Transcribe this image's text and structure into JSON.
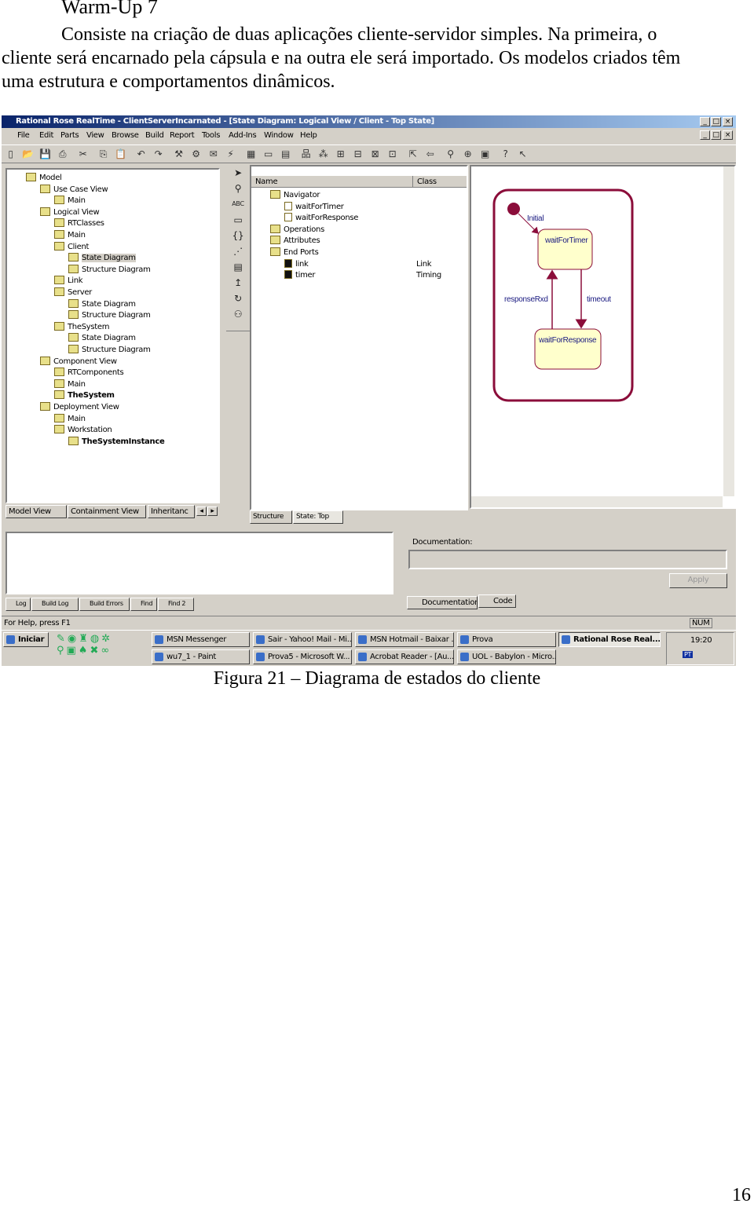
{
  "document": {
    "heading": "Warm-Up 7",
    "paragraph_lines": [
      "Consiste na criação de duas aplicações cliente-servidor simples. Na primeira, o",
      "cliente será encarnado pela cápsula e na outra ele será importado. Os modelos criados têm",
      "uma estrutura e comportamentos dinâmicos."
    ],
    "caption": "Figura 21 – Diagrama de estados do cliente",
    "page_number": "16"
  },
  "app": {
    "title": "Rational Rose RealTime - ClientServerIncarnated - [State Diagram: Logical View / Client - Top State]",
    "menu": [
      "File",
      "Edit",
      "Parts",
      "View",
      "Browse",
      "Build",
      "Report",
      "Tools",
      "Add-Ins",
      "Window",
      "Help"
    ],
    "toolbar_icons": [
      "new-icon",
      "open-icon",
      "save-icon",
      "print-icon",
      "cut-icon",
      "copy-icon",
      "paste-icon",
      "undo-icon",
      "redo-icon",
      "build-icon",
      "run-icon",
      "compile-icon",
      "lightning-icon",
      "browser-icon",
      "window-icon",
      "split-icon",
      "class-diagram-icon",
      "usecase-icon",
      "component-icon",
      "deployment-icon",
      "structure-icon",
      "state-icon",
      "navigate-icon",
      "back-icon",
      "zoom-icon",
      "fit-icon",
      "layout-icon",
      "help-icon",
      "whats-this-icon"
    ],
    "tree": [
      {
        "label": "Model",
        "level": 0
      },
      {
        "label": "Use Case View",
        "level": 1
      },
      {
        "label": "Main",
        "level": 2
      },
      {
        "label": "Logical View",
        "level": 1
      },
      {
        "label": "RTClasses",
        "level": 2
      },
      {
        "label": "Main",
        "level": 2
      },
      {
        "label": "Client",
        "level": 2
      },
      {
        "label": "State Diagram",
        "level": 3,
        "selected": true
      },
      {
        "label": "Structure Diagram",
        "level": 3
      },
      {
        "label": "Link",
        "level": 2
      },
      {
        "label": "Server",
        "level": 2
      },
      {
        "label": "State Diagram",
        "level": 3
      },
      {
        "label": "Structure Diagram",
        "level": 3
      },
      {
        "label": "TheSystem",
        "level": 2
      },
      {
        "label": "State Diagram",
        "level": 3
      },
      {
        "label": "Structure Diagram",
        "level": 3
      },
      {
        "label": "Component View",
        "level": 1
      },
      {
        "label": "RTComponents",
        "level": 2
      },
      {
        "label": "Main",
        "level": 2
      },
      {
        "label": "TheSystem",
        "level": 2,
        "bold": true
      },
      {
        "label": "Deployment View",
        "level": 1
      },
      {
        "label": "Main",
        "level": 2
      },
      {
        "label": "Workstation",
        "level": 2
      },
      {
        "label": "TheSystemInstance",
        "level": 3,
        "bold": true
      }
    ],
    "tree_tabs": [
      "Model View",
      "Containment View",
      "Inheritanc"
    ],
    "list_headers": {
      "name": "Name",
      "class": "Class"
    },
    "list_items": [
      {
        "name": "Navigator",
        "level": 0,
        "class": ""
      },
      {
        "name": "waitForTimer",
        "level": 1,
        "class": ""
      },
      {
        "name": "waitForResponse",
        "level": 1,
        "class": ""
      },
      {
        "name": "Operations",
        "level": 0,
        "class": ""
      },
      {
        "name": "Attributes",
        "level": 0,
        "class": ""
      },
      {
        "name": "End Ports",
        "level": 0,
        "class": ""
      },
      {
        "name": "link",
        "level": 1,
        "class": "Link"
      },
      {
        "name": "timer",
        "level": 1,
        "class": "Timing"
      }
    ],
    "list_tabs": [
      "Structure",
      "State: Top"
    ],
    "diagram": {
      "initial_label": "Initial",
      "state1": "waitForTimer",
      "state2": "waitForResponse",
      "transition_up": "responseRxd",
      "transition_down": "timeout",
      "state_color": "#ffffcc",
      "line_color": "#8b0d3a"
    },
    "log_tabs": [
      "Log",
      "Build Log",
      "Build Errors",
      "Find",
      "Find 2"
    ],
    "doc_label": "Documentation:",
    "apply_label": "Apply",
    "doc_tabs": [
      "Documentation",
      "Code"
    ],
    "status_text": "For Help, press F1",
    "status_num": "NUM",
    "start_label": "Iniciar",
    "taskbar_row1": [
      "MSN Messenger",
      "Sair - Yahoo! Mail - Mi...",
      "MSN Hotmail - Baixar ...",
      "Prova",
      "Rational Rose Real..."
    ],
    "taskbar_row2": [
      "wu7_1 - Paint",
      "Prova5 - Microsoft W...",
      "Acrobat Reader - [Au...",
      "UOL - Babylon - Micro..."
    ],
    "clock": "19:20",
    "tray_lang": "PT"
  }
}
